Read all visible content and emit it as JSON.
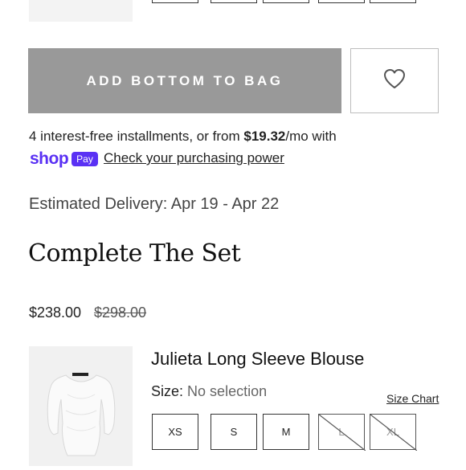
{
  "buttons": {
    "add_to_bag": "ADD BOTTOM TO BAG"
  },
  "installments": {
    "prefix": "4 interest-free installments, or from ",
    "amount": "$19.32",
    "suffix": "/mo with",
    "shop_word": "shop",
    "pay_word": "Pay",
    "link": "Check your purchasing power"
  },
  "delivery": "Estimated Delivery: Apr 19 - Apr 22",
  "complete_set": {
    "title": "Complete The Set",
    "price_now": "$238.00",
    "price_was": "$298.00",
    "product_name": "Julieta Long Sleeve Blouse",
    "size_label": "Size:",
    "size_value": "No selection",
    "size_chart": "Size Chart",
    "sizes": [
      {
        "label": "XS",
        "available": true
      },
      {
        "label": "S",
        "available": true
      },
      {
        "label": "M",
        "available": true
      },
      {
        "label": "L",
        "available": false
      },
      {
        "label": "XL",
        "available": false
      }
    ]
  },
  "colors": {
    "button_gray": "#999999",
    "shop_pay_purple": "#5a31f4"
  },
  "icons": {
    "wishlist": "heart-icon"
  }
}
